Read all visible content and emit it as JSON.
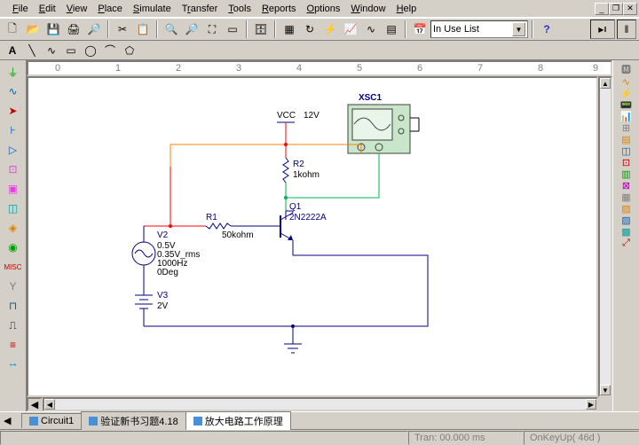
{
  "menu": [
    "File",
    "Edit",
    "View",
    "Place",
    "Simulate",
    "Transfer",
    "Tools",
    "Reports",
    "Options",
    "Window",
    "Help"
  ],
  "combo": {
    "value": "In Use List"
  },
  "ruler": [
    "0",
    "1",
    "2",
    "3",
    "4",
    "5",
    "6",
    "7",
    "8",
    "9"
  ],
  "scope": {
    "name": "XSC1"
  },
  "components": {
    "vcc": {
      "name": "VCC",
      "val": "12V"
    },
    "r1": {
      "name": "R1",
      "val": "50kohm"
    },
    "r2": {
      "name": "R2",
      "val": "1kohm"
    },
    "q1": {
      "name": "Q1",
      "val": "2N2222A"
    },
    "v2": {
      "name": "V2",
      "l1": "0.5V",
      "l2": "0.35V_rms",
      "l3": "1000Hz",
      "l4": "0Deg"
    },
    "v3": {
      "name": "V3",
      "val": "2V"
    }
  },
  "tabs": [
    "Circuit1",
    "验证新书习题4.18",
    "放大电路工作原理"
  ],
  "status": {
    "time": "Tran: 00.000 ms",
    "key": "OnKeyUp( 46d )"
  }
}
